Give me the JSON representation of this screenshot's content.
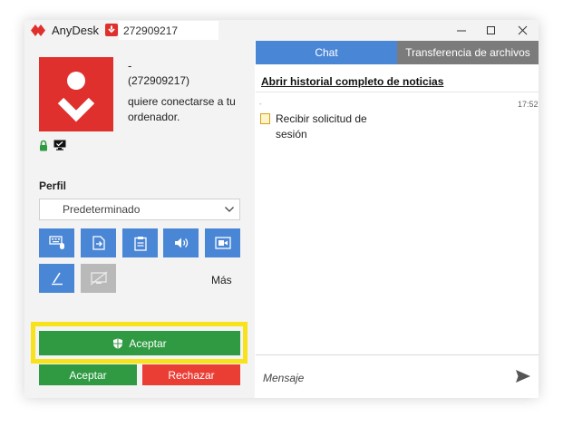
{
  "titlebar": {
    "app_name": "AnyDesk",
    "address": "272909217"
  },
  "incoming": {
    "name": "-",
    "id": "(272909217)",
    "message": "quiere conectarse a tu ordenador."
  },
  "profile": {
    "label": "Perfil",
    "selected": "Predeterminado"
  },
  "permissions": [
    {
      "name": "keyboard-mouse",
      "icon": "keyboard-mouse-icon",
      "enabled": true
    },
    {
      "name": "file-transfer",
      "icon": "file-transfer-icon",
      "enabled": true
    },
    {
      "name": "clipboard",
      "icon": "clipboard-icon",
      "enabled": true
    },
    {
      "name": "sound",
      "icon": "speaker-icon",
      "enabled": true
    },
    {
      "name": "recording",
      "icon": "camera-icon",
      "enabled": true
    },
    {
      "name": "draw",
      "icon": "pen-icon",
      "enabled": true
    },
    {
      "name": "privacy-mode",
      "icon": "monitor-off-icon",
      "enabled": false
    }
  ],
  "more_label": "Más",
  "actions": {
    "accept_with_elevation": "Aceptar",
    "accept": "Aceptar",
    "reject": "Rechazar"
  },
  "tabs": [
    {
      "label": "Chat",
      "active": true
    },
    {
      "label": "Transferencia de archivos",
      "active": false
    }
  ],
  "chat": {
    "history_link": "Abrir historial completo de noticias",
    "messages": [
      {
        "sender": "-",
        "time": "17:52",
        "text": "Recibir solicitud de sesión"
      }
    ],
    "input_placeholder": "Mensaje"
  },
  "colors": {
    "brand_red": "#e0302e",
    "accent_blue": "#4a86d6",
    "accept_green": "#2f9a42",
    "reject_red": "#ea3d34",
    "highlight_yellow": "#f7e21c"
  }
}
